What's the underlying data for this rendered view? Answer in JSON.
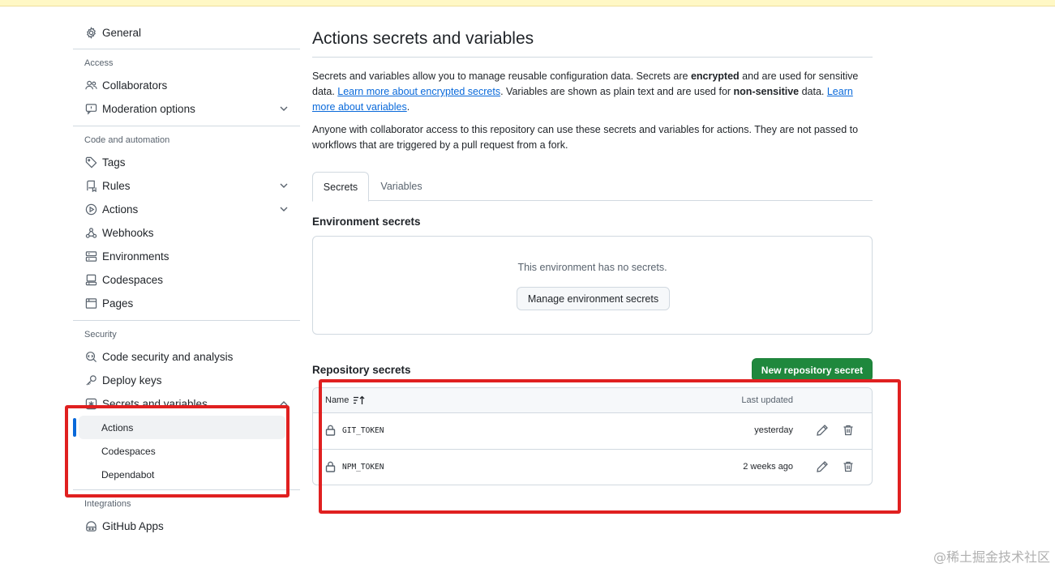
{
  "sidebar": {
    "general": "General",
    "access": {
      "heading": "Access",
      "collaborators": "Collaborators",
      "moderation": "Moderation options"
    },
    "code_automation": {
      "heading": "Code and automation",
      "tags": "Tags",
      "rules": "Rules",
      "actions": "Actions",
      "webhooks": "Webhooks",
      "environments": "Environments",
      "codespaces": "Codespaces",
      "pages": "Pages"
    },
    "security": {
      "heading": "Security",
      "code_security": "Code security and analysis",
      "deploy_keys": "Deploy keys",
      "secrets_variables": "Secrets and variables",
      "sub_actions": "Actions",
      "sub_codespaces": "Codespaces",
      "sub_dependabot": "Dependabot"
    },
    "integrations": {
      "heading": "Integrations",
      "github_apps": "GitHub Apps"
    }
  },
  "main": {
    "title": "Actions secrets and variables",
    "intro": {
      "t1": "Secrets and variables allow you to manage reusable configuration data. Secrets are ",
      "b1": "encrypted",
      "t2": " and are used for sensitive data. ",
      "link1": "Learn more about encrypted secrets",
      "t3": ". Variables are shown as plain text and are used for ",
      "b2": "non-sensitive",
      "t4": " data. ",
      "link2": "Learn more about variables",
      "t5": "."
    },
    "access_note": "Anyone with collaborator access to this repository can use these secrets and variables for actions. They are not passed to workflows that are triggered by a pull request from a fork.",
    "tabs": [
      "Secrets",
      "Variables"
    ],
    "environment": {
      "title": "Environment secrets",
      "empty": "This environment has no secrets.",
      "button": "Manage environment secrets"
    },
    "repository": {
      "title": "Repository secrets",
      "new_button": "New repository secret",
      "col_name": "Name",
      "col_updated": "Last updated",
      "rows": [
        {
          "name": "GIT_TOKEN",
          "updated": "yesterday"
        },
        {
          "name": "NPM_TOKEN",
          "updated": "2 weeks ago"
        }
      ]
    }
  },
  "watermark": "@稀土掘金技术社区",
  "colors": {
    "accent": "#0969da",
    "primary_button": "#1f883d",
    "annotation": "#e02020"
  }
}
